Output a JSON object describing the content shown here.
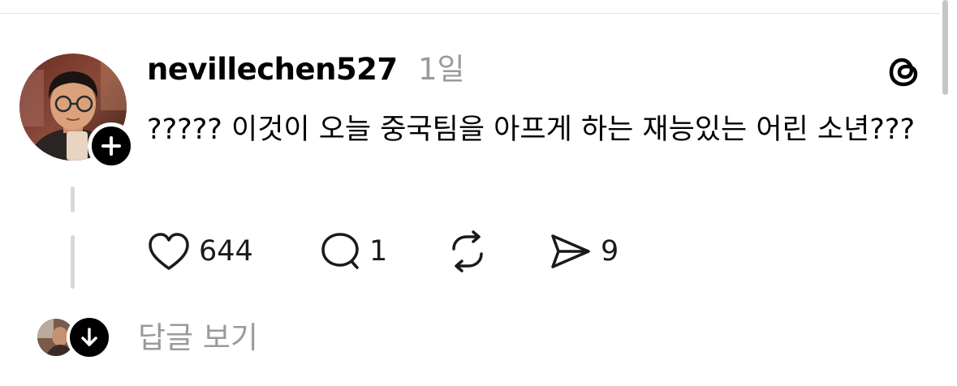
{
  "post": {
    "username": "nevillechen527",
    "timestamp": "1일",
    "text": "????? 이것이 오늘 중국팀을 아프게 하는 재능있는 어린 소년???"
  },
  "actions": {
    "like_count": "644",
    "reply_count": "1",
    "share_count": "9"
  },
  "replies": {
    "view_label": "답글 보기"
  },
  "icons": {
    "follow": "plus-icon",
    "logo": "threads-logo-icon",
    "like": "heart-icon",
    "reply": "speech-bubble-icon",
    "repost": "repost-icon",
    "share": "send-icon",
    "expand": "arrow-down-icon"
  },
  "colors": {
    "text": "#000000",
    "muted": "#9a9a9a",
    "thread_line": "#d8d8d8",
    "badge": "#000000"
  }
}
